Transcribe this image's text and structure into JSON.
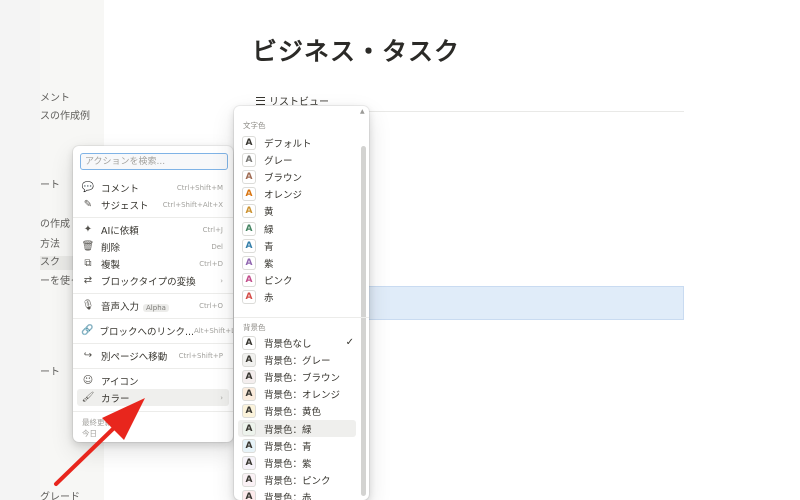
{
  "sidebar": {
    "items": [
      {
        "label": "メント"
      },
      {
        "label": "スの作成例"
      },
      {
        "label": "ート"
      },
      {
        "label": "の作成"
      },
      {
        "label": "方法"
      },
      {
        "label": "スク"
      },
      {
        "label": "ーを使った"
      },
      {
        "label": "ート"
      },
      {
        "label": "グレード"
      }
    ]
  },
  "page": {
    "title": "ビジネス・タスク",
    "view_tab": "リストビュー"
  },
  "action_menu": {
    "search_placeholder": "アクションを検索...",
    "items": [
      {
        "icon": "💬",
        "label": "コメント",
        "shortcut": "Ctrl+Shift+M"
      },
      {
        "icon": "✎",
        "label": "サジェスト",
        "shortcut": "Ctrl+Shift+Alt+X"
      },
      {
        "icon": "✦",
        "label": "AIに依頼",
        "shortcut": "Ctrl+J"
      },
      {
        "icon": "🗑",
        "label": "削除",
        "shortcut": "Del"
      },
      {
        "icon": "⧉",
        "label": "複製",
        "shortcut": "Ctrl+D"
      },
      {
        "icon": "⇄",
        "label": "ブロックタイプの変換",
        "shortcut": "›"
      },
      {
        "icon": "🎙",
        "label": "音声入力",
        "badge": "Alpha",
        "shortcut": "Ctrl+O"
      },
      {
        "icon": "🔗",
        "label": "ブロックへのリンク...",
        "shortcut": "Alt+Shift+L"
      },
      {
        "icon": "↪",
        "label": "別ページへ移動",
        "shortcut": "Ctrl+Shift+P"
      },
      {
        "icon": "☺",
        "label": "アイコン",
        "shortcut": ""
      },
      {
        "icon": "🖌",
        "label": "カラー",
        "shortcut": "›"
      }
    ],
    "footer_line1": "最終更新者",
    "footer_line2": "今日"
  },
  "color_menu": {
    "text_heading": "文字色",
    "text_colors": [
      {
        "label": "デフォルト",
        "color": "#37352f"
      },
      {
        "label": "グレー",
        "color": "#787774"
      },
      {
        "label": "ブラウン",
        "color": "#9f6b53"
      },
      {
        "label": "オレンジ",
        "color": "#d9730d"
      },
      {
        "label": "黄",
        "color": "#cb912f"
      },
      {
        "label": "緑",
        "color": "#448361"
      },
      {
        "label": "青",
        "color": "#337ea9"
      },
      {
        "label": "紫",
        "color": "#9065b0"
      },
      {
        "label": "ピンク",
        "color": "#c14c8a"
      },
      {
        "label": "赤",
        "color": "#d44c47"
      }
    ],
    "bg_heading": "背景色",
    "bg_colors": [
      {
        "label": "背景色なし",
        "bg": "#ffffff",
        "selected": true
      },
      {
        "label": "背景色：グレー",
        "bg": "#f1f1ef"
      },
      {
        "label": "背景色：ブラウン",
        "bg": "#f4eeee"
      },
      {
        "label": "背景色：オレンジ",
        "bg": "#fbecdd"
      },
      {
        "label": "背景色：黄色",
        "bg": "#fbf3db"
      },
      {
        "label": "背景色：緑",
        "bg": "#edf3ec",
        "hover": true
      },
      {
        "label": "背景色：青",
        "bg": "#e7f3f8"
      },
      {
        "label": "背景色：紫",
        "bg": "#f6f3f9"
      },
      {
        "label": "背景色：ピンク",
        "bg": "#faf1f5"
      },
      {
        "label": "背景色：赤",
        "bg": "#fdebec"
      }
    ],
    "swatch_letter": "A",
    "check_mark": "✓"
  },
  "annotation": {
    "arrow_color": "#e8261d"
  }
}
